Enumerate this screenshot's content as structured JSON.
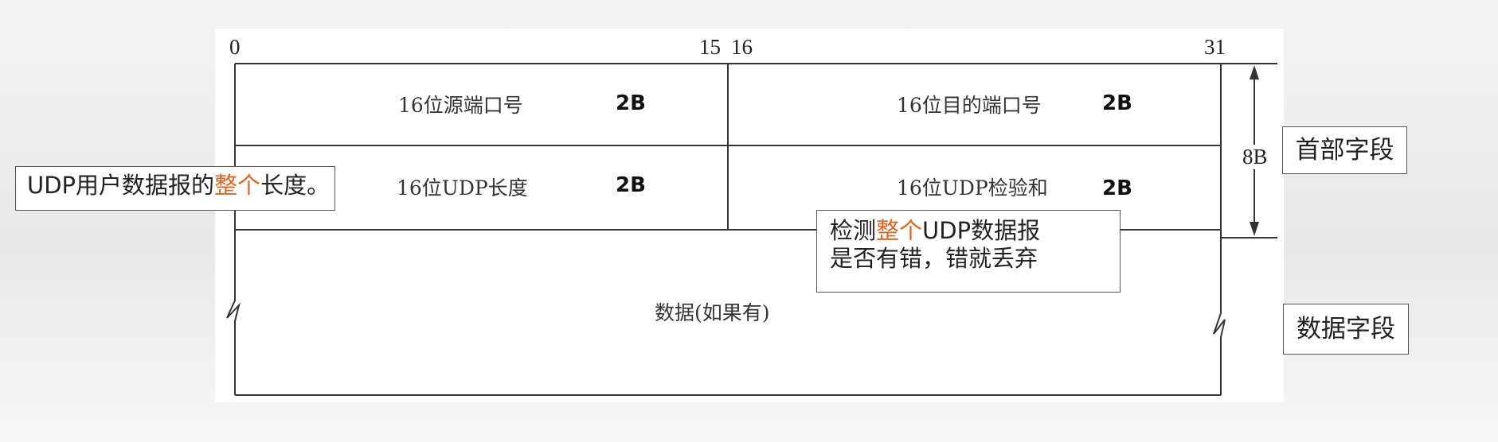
{
  "bit_positions": {
    "start": "0",
    "mid_left": "15",
    "mid_right": "16",
    "end": "31"
  },
  "header_fields": {
    "source_port": {
      "label": "16位源端口号",
      "size": "2B"
    },
    "dest_port": {
      "label": "16位目的端口号",
      "size": "2B"
    },
    "length": {
      "label": "16位UDP长度",
      "size": "2B"
    },
    "checksum": {
      "label": "16位UDP检验和",
      "size": "2B"
    }
  },
  "data_field": {
    "label": "数据(如果有)"
  },
  "header_size": "8B",
  "section_labels": {
    "header": "首部字段",
    "data": "数据字段"
  },
  "callouts": {
    "length_note": {
      "prefix": "UDP用户数据报的",
      "highlight": "整个",
      "suffix": "长度。"
    },
    "checksum_note": {
      "line1_prefix": "检测",
      "line1_highlight": "整个",
      "line1_suffix": "UDP数据报",
      "line2": "是否有错，错就丢弃"
    }
  },
  "colors": {
    "highlight": "#e0651f",
    "line": "#333333",
    "background": "#ffffff"
  }
}
